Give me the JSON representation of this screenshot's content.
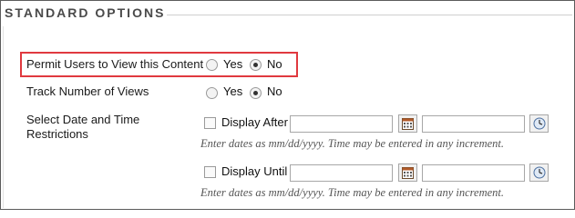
{
  "section": {
    "title": "STANDARD OPTIONS"
  },
  "permit_view": {
    "label": "Permit Users to View this Content",
    "yes_label": "Yes",
    "no_label": "No",
    "selected": "No"
  },
  "track_views": {
    "label": "Track Number of Views",
    "yes_label": "Yes",
    "no_label": "No",
    "selected": "No"
  },
  "date_restrictions": {
    "label_line1": "Select Date and Time",
    "label_line2": "Restrictions",
    "display_after": {
      "label": "Display After",
      "date_value": "",
      "time_value": "",
      "hint": "Enter dates as mm/dd/yyyy. Time may be entered in any increment."
    },
    "display_until": {
      "label": "Display Until",
      "date_value": "",
      "time_value": "",
      "hint": "Enter dates as mm/dd/yyyy. Time may be entered in any increment."
    }
  },
  "colors": {
    "highlight_border": "#e0393f",
    "legend_text": "#4a4a4a"
  },
  "icons": {
    "calendar": "calendar-icon",
    "clock": "clock-icon"
  }
}
